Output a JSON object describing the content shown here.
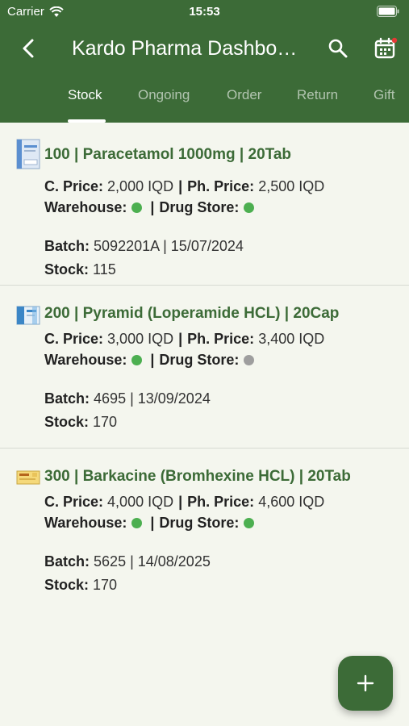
{
  "status": {
    "carrier": "Carrier",
    "time": "15:53"
  },
  "header": {
    "title": "Kardo Pharma Dashbo…",
    "tabs": [
      "Stock",
      "Ongoing",
      "Order",
      "Return",
      "Gift"
    ],
    "active_tab": "Stock"
  },
  "labels": {
    "c_price": "C. Price:",
    "ph_price": "Ph. Price:",
    "warehouse": "Warehouse:",
    "drug_store": "Drug Store:",
    "batch": "Batch:",
    "stock": "Stock:",
    "separator": "|"
  },
  "colors": {
    "brand": "#3c6b37",
    "available": "#4caf50",
    "unavailable": "#9e9e9e"
  },
  "items": [
    {
      "title": "100 | Paracetamol 1000mg | 20Tab",
      "c_price": "2,000 IQD",
      "ph_price": "2,500 IQD",
      "warehouse_status": "available",
      "drug_store_status": "available",
      "batch": "5092201A | 15/07/2024",
      "stock": "115",
      "icon": "medicine-box-icon"
    },
    {
      "title": "200 | Pyramid (Loperamide HCL) | 20Cap",
      "c_price": "3,000 IQD",
      "ph_price": "3,400 IQD",
      "warehouse_status": "available",
      "drug_store_status": "unavailable",
      "batch": "4695 | 13/09/2024",
      "stock": "170",
      "icon": "medicine-box-icon"
    },
    {
      "title": "300 | Barkacine (Bromhexine HCL) | 20Tab",
      "c_price": "4,000 IQD",
      "ph_price": "4,600 IQD",
      "warehouse_status": "available",
      "drug_store_status": "available",
      "batch": "5625 | 14/08/2025",
      "stock": "170",
      "icon": "medicine-box-icon"
    }
  ]
}
